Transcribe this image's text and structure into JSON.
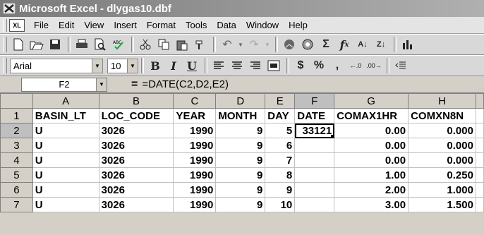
{
  "window": {
    "title": "Microsoft Excel - dlygas10.dbf"
  },
  "menu": {
    "items": [
      "File",
      "Edit",
      "View",
      "Insert",
      "Format",
      "Tools",
      "Data",
      "Window",
      "Help"
    ]
  },
  "format_toolbar": {
    "font_name": "Arial",
    "font_size": "10"
  },
  "formula_bar": {
    "cell_ref": "F2",
    "equals": "=",
    "formula": "=DATE(C2,D2,E2)"
  },
  "sheet": {
    "columns": [
      "A",
      "B",
      "C",
      "D",
      "E",
      "F",
      "G",
      "H"
    ],
    "row_numbers": [
      "1",
      "2",
      "3",
      "4",
      "5",
      "6",
      "7"
    ],
    "header_row": [
      "BASIN_LT",
      "LOC_CODE",
      "YEAR",
      "MONTH",
      "DAY",
      "DATE",
      "COMAX1HR",
      "COMXN8N"
    ],
    "rows": [
      [
        "U",
        "3026",
        "1990",
        "9",
        "5",
        "33121",
        "0.00",
        "0.000"
      ],
      [
        "U",
        "3026",
        "1990",
        "9",
        "6",
        "",
        "0.00",
        "0.000"
      ],
      [
        "U",
        "3026",
        "1990",
        "9",
        "7",
        "",
        "0.00",
        "0.000"
      ],
      [
        "U",
        "3026",
        "1990",
        "9",
        "8",
        "",
        "1.00",
        "0.250"
      ],
      [
        "U",
        "3026",
        "1990",
        "9",
        "9",
        "",
        "2.00",
        "1.000"
      ],
      [
        "U",
        "3026",
        "1990",
        "9",
        "10",
        "",
        "3.00",
        "1.500"
      ]
    ]
  }
}
